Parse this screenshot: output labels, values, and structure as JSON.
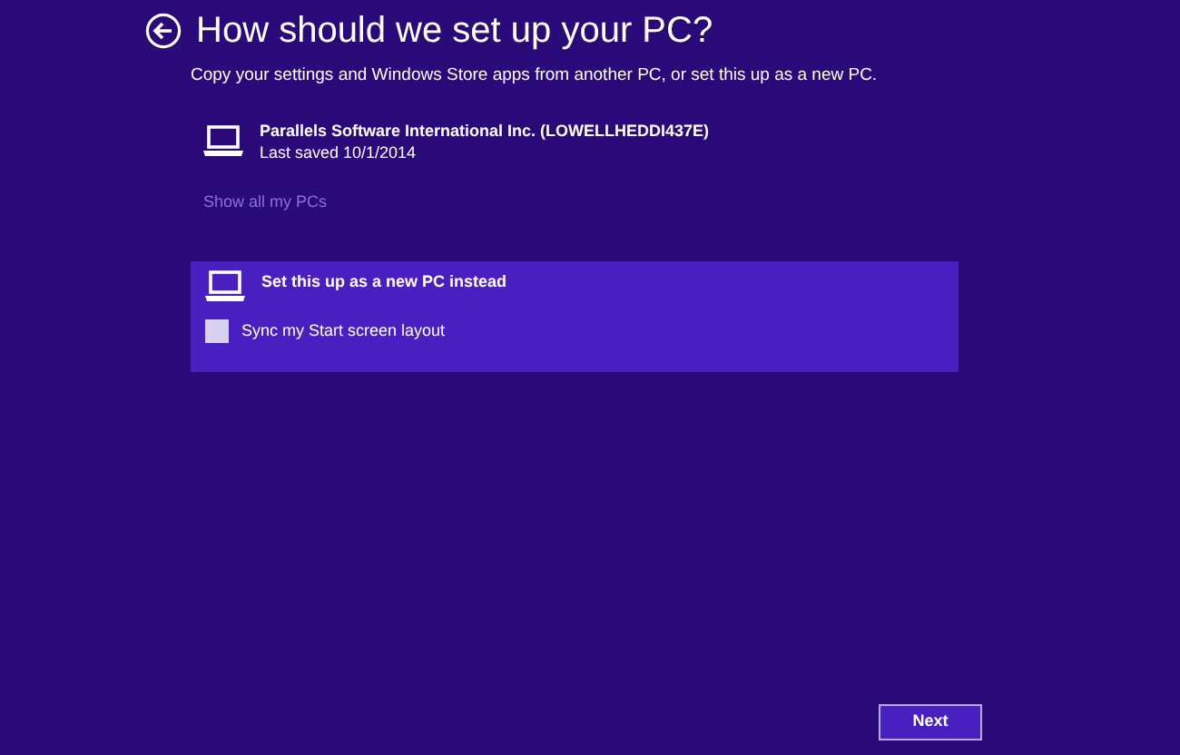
{
  "title": "How should we set up your PC?",
  "subtitle": "Copy your settings and Windows Store apps from another PC, or set this up as a new PC.",
  "pcs": [
    {
      "name": "Parallels Software International Inc. (LOWELLHEDDI437E)",
      "detail": "Last saved 10/1/2014",
      "selected": false
    }
  ],
  "show_all_link": "Show all my PCs",
  "new_pc": {
    "label": "Set this up as a new PC instead",
    "selected": true,
    "sync": {
      "label": "Sync my Start screen layout",
      "checked": false
    }
  },
  "next_button": "Next"
}
